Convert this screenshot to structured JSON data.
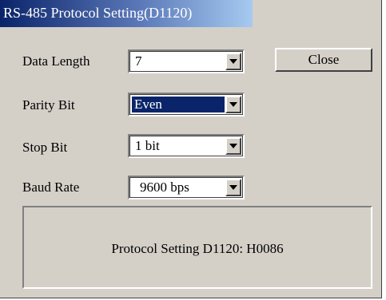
{
  "window": {
    "title": "RS-485 Protocol Setting(D1120)"
  },
  "fields": [
    {
      "label": "Data Length",
      "value": "7"
    },
    {
      "label": "Parity Bit",
      "value": "Even",
      "focused": true
    },
    {
      "label": "Stop Bit",
      "value": "1 bit"
    },
    {
      "label": "Baud Rate",
      "value": "9600 bps"
    }
  ],
  "close_button": {
    "label": "Close"
  },
  "status": {
    "text": "Protocol Setting D1120: H0086"
  },
  "colors": {
    "title_gradient_start": "#0a246a",
    "title_gradient_end": "#a6caf0",
    "dialog_face": "#d4d0c8",
    "selection": "#0a246a"
  }
}
